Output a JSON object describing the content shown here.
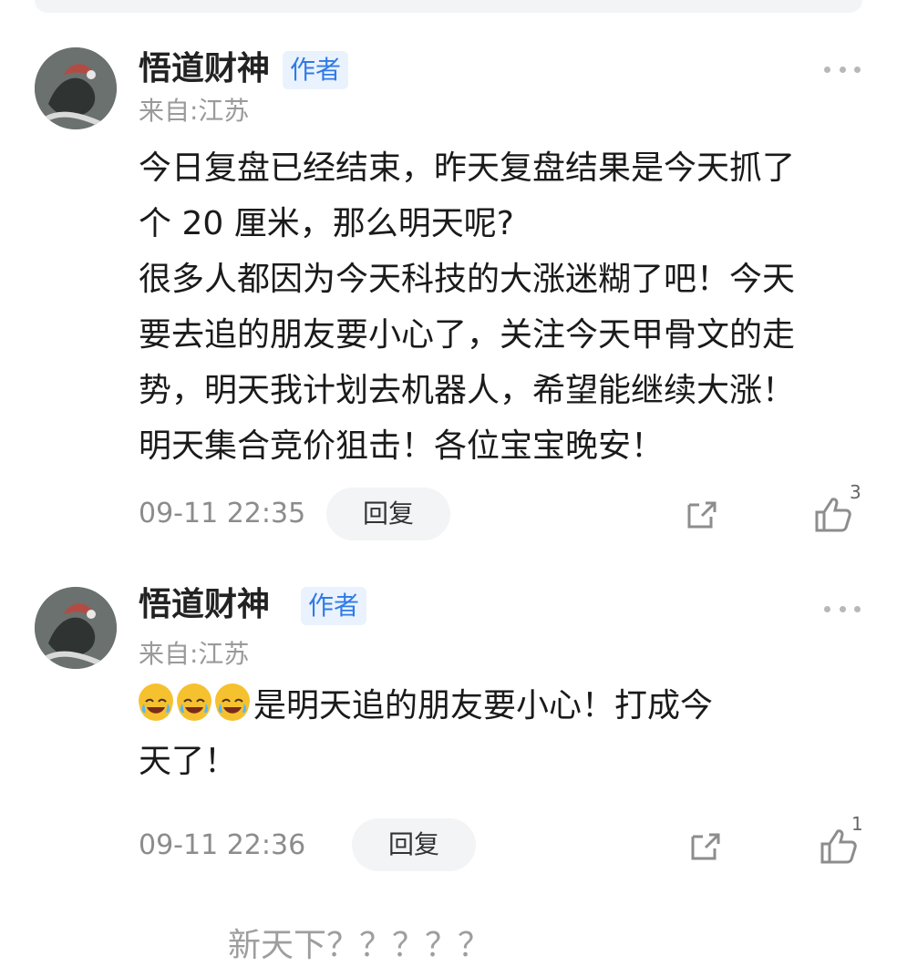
{
  "comments": [
    {
      "author": "悟道财神",
      "badge": "作者",
      "location": "来自:江苏",
      "content_lines": [
        "今日复盘已经结束，昨天复盘结果是今天抓了",
        "个 20 厘米，那么明天呢?",
        "很多人都因为今天科技的大涨迷糊了吧！今天",
        "要去追的朋友要小心了，关注今天甲骨文的走",
        "势，明天我计划去机器人，希望能继续大涨！",
        "明天集合竞价狙击！各位宝宝晚安！"
      ],
      "time": "09-11 22:35",
      "reply_label": "回复",
      "likes": "3",
      "icons": [
        "more-icon",
        "share-icon",
        "like-icon"
      ]
    },
    {
      "author": "悟道财神",
      "badge": "作者",
      "location": "来自:江苏",
      "emoji": [
        "crying-laughing-emoji",
        "crying-laughing-emoji",
        "crying-laughing-emoji"
      ],
      "content_lines": [
        "是明天追的朋友要小心！打成今",
        "天了！"
      ],
      "time": "09-11 22:36",
      "reply_label": "回复",
      "likes": "1",
      "icons": [
        "more-icon",
        "share-icon",
        "like-icon"
      ]
    }
  ],
  "footer": {
    "text": "新天下？？？？？"
  },
  "colors": {
    "badge_bg": "#eaf2fd",
    "badge_text": "#2f7be6",
    "muted": "#8c8c8c",
    "reply_bg": "#f3f4f6"
  }
}
